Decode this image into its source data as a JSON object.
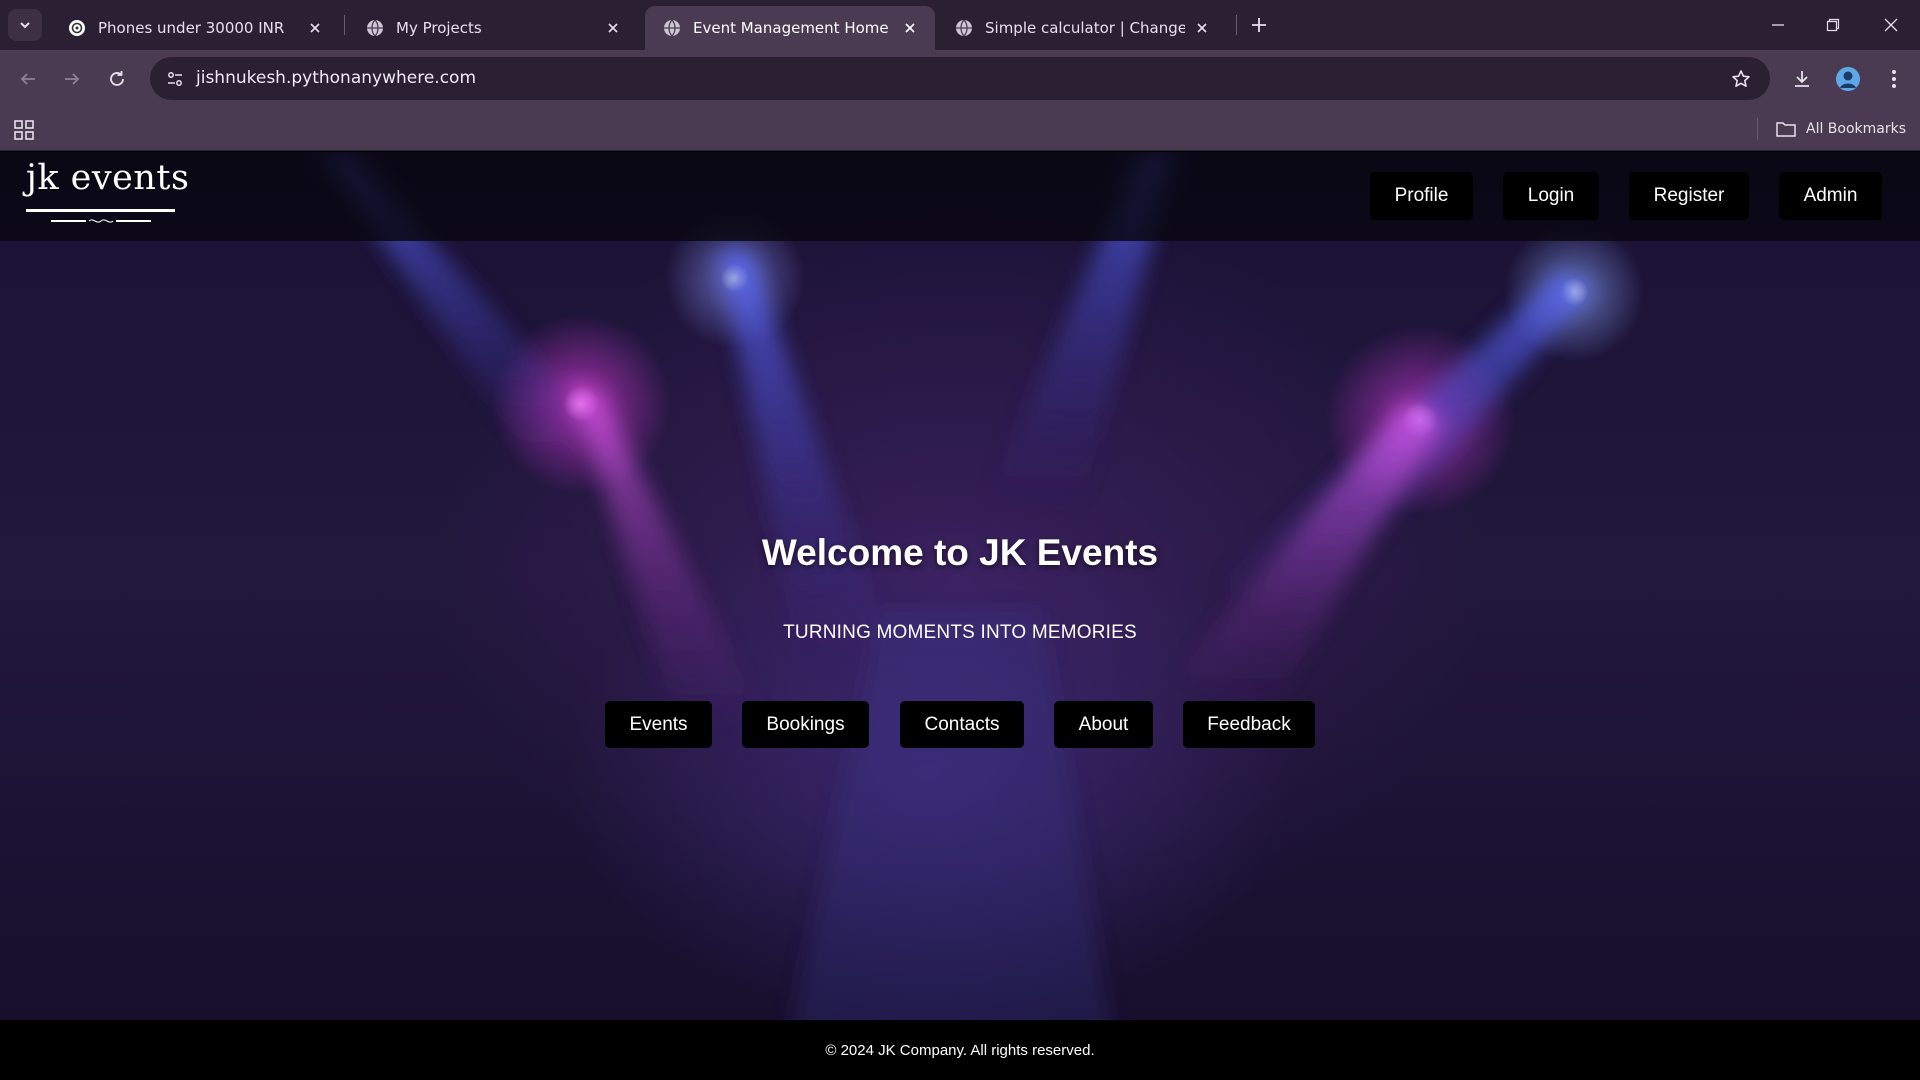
{
  "browser": {
    "tabs": [
      {
        "title": "Phones under 30000 INR",
        "favicon": "openai-icon",
        "active": false
      },
      {
        "title": "My Projects",
        "favicon": "globe-icon",
        "active": false
      },
      {
        "title": "Event Management Home",
        "favicon": "globe-icon",
        "active": true
      },
      {
        "title": "Simple calculator | Change proj",
        "favicon": "globe-icon",
        "active": false
      }
    ],
    "url": "jishnukesh.pythonanywhere.com",
    "bookmarks_label": "All Bookmarks"
  },
  "site": {
    "logo_text": "jk events",
    "nav": {
      "profile": "Profile",
      "login": "Login",
      "register": "Register",
      "admin": "Admin"
    },
    "hero": {
      "title": "Welcome to JK Events",
      "subtitle": "TURNING MOMENTS INTO MEMORIES",
      "buttons": {
        "events": "Events",
        "bookings": "Bookings",
        "contacts": "Contacts",
        "about": "About",
        "feedback": "Feedback"
      }
    },
    "footer": "© 2024 JK Company. All rights reserved."
  },
  "colors": {
    "tab_bar": "#2a1f33",
    "toolbar": "#4a3b52",
    "header_bg": "#08060f",
    "button_bg": "#000000",
    "spotlight_blue": "#4b5bff",
    "spotlight_magenta": "#e04fe8"
  }
}
